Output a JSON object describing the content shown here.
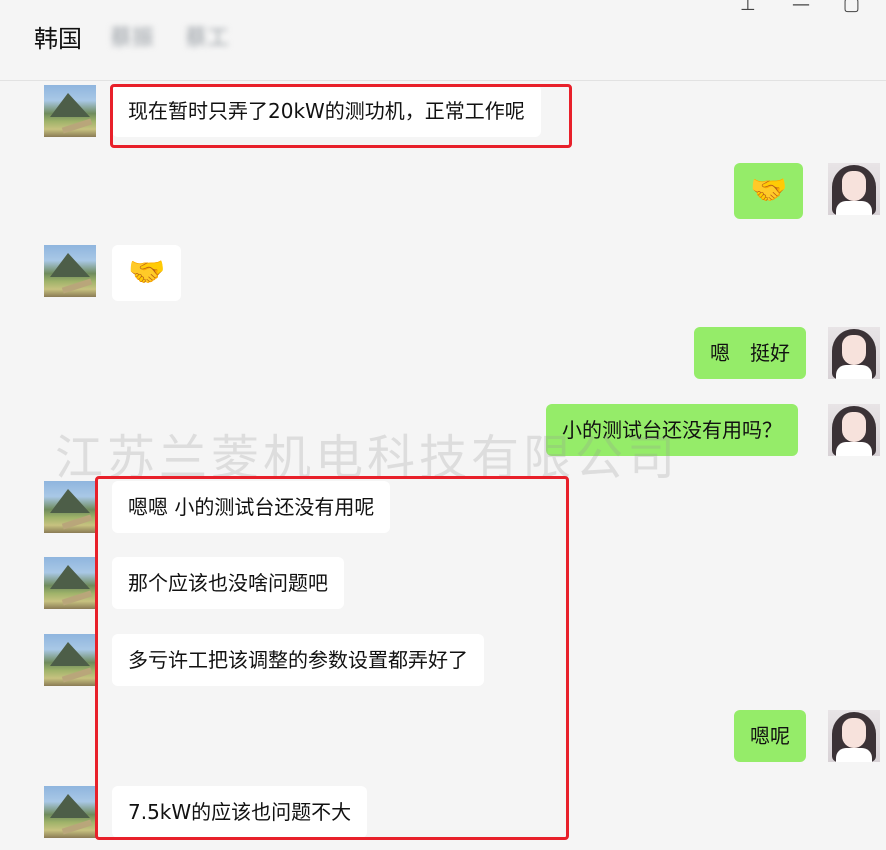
{
  "header": {
    "title": "韩国",
    "blurred_1": "蔡振",
    "blurred_2": "蔡工"
  },
  "window_controls": {
    "pin": "⊥",
    "minimize": "—",
    "maximize": "▢"
  },
  "messages": [
    {
      "side": "left",
      "text": "现在暂时只弄了20kW的测功机，正常工作呢"
    },
    {
      "side": "right",
      "text": "🤝"
    },
    {
      "side": "left",
      "text": "🤝"
    },
    {
      "side": "right",
      "text": "嗯　挺好"
    },
    {
      "side": "right",
      "text": "小的测试台还没有用吗？"
    },
    {
      "side": "left",
      "text": "嗯嗯 小的测试台还没有用呢"
    },
    {
      "side": "left",
      "text": "那个应该也没啥问题吧"
    },
    {
      "side": "left",
      "text": "多亏许工把该调整的参数设置都弄好了"
    },
    {
      "side": "right",
      "text": "嗯呢"
    },
    {
      "side": "left",
      "text": "7.5kW的应该也问题不大"
    }
  ],
  "watermark": "江苏兰菱机电科技有限公司",
  "colors": {
    "highlight": "#e8202a",
    "sent_bubble": "#95ec69",
    "received_bubble": "#ffffff"
  }
}
